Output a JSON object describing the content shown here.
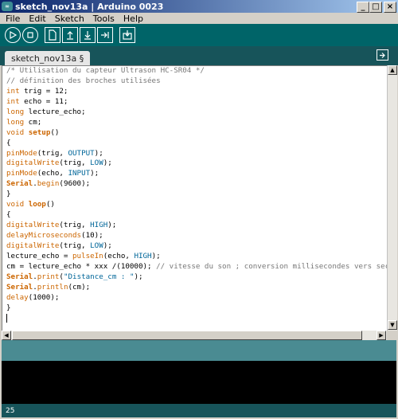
{
  "window": {
    "title": "sketch_nov13a | Arduino 0023",
    "app_icon": "arduino-icon"
  },
  "menubar": [
    "File",
    "Edit",
    "Sketch",
    "Tools",
    "Help"
  ],
  "toolbar": {
    "buttons": [
      "verify-icon",
      "stop-icon",
      "new-icon",
      "open-icon",
      "save-icon",
      "upload-icon",
      "serial-monitor-icon"
    ]
  },
  "tabs": [
    {
      "label": "sketch_nov13a §"
    }
  ],
  "editor": {
    "lines": [
      [
        {
          "t": "/* Utilisation du capteur Ultrason HC-SR04 */",
          "c": "comment"
        }
      ],
      [
        {
          "t": "// définition des broches utilisées",
          "c": "comment"
        }
      ],
      [
        {
          "t": "int",
          "c": "type"
        },
        {
          "t": " trig = 12;",
          "c": ""
        }
      ],
      [
        {
          "t": "int",
          "c": "type"
        },
        {
          "t": " echo = 11;",
          "c": ""
        }
      ],
      [
        {
          "t": "long",
          "c": "type"
        },
        {
          "t": " lecture_echo;",
          "c": ""
        }
      ],
      [
        {
          "t": "long",
          "c": "type"
        },
        {
          "t": " cm;",
          "c": ""
        }
      ],
      [
        {
          "t": "void",
          "c": "type"
        },
        {
          "t": " ",
          "c": ""
        },
        {
          "t": "setup",
          "c": "func-b"
        },
        {
          "t": "()",
          "c": ""
        }
      ],
      [
        {
          "t": "{",
          "c": ""
        }
      ],
      [
        {
          "t": "pinMode",
          "c": "func"
        },
        {
          "t": "(trig, ",
          "c": ""
        },
        {
          "t": "OUTPUT",
          "c": "const"
        },
        {
          "t": ");",
          "c": ""
        }
      ],
      [
        {
          "t": "digitalWrite",
          "c": "func"
        },
        {
          "t": "(trig, ",
          "c": ""
        },
        {
          "t": "LOW",
          "c": "const"
        },
        {
          "t": ");",
          "c": ""
        }
      ],
      [
        {
          "t": "pinMode",
          "c": "func"
        },
        {
          "t": "(echo, ",
          "c": ""
        },
        {
          "t": "INPUT",
          "c": "const"
        },
        {
          "t": ");",
          "c": ""
        }
      ],
      [
        {
          "t": "Serial",
          "c": "func-b"
        },
        {
          "t": ".",
          "c": ""
        },
        {
          "t": "begin",
          "c": "func"
        },
        {
          "t": "(9600);",
          "c": ""
        }
      ],
      [
        {
          "t": "}",
          "c": ""
        }
      ],
      [
        {
          "t": "void",
          "c": "type"
        },
        {
          "t": " ",
          "c": ""
        },
        {
          "t": "loop",
          "c": "func-b"
        },
        {
          "t": "()",
          "c": ""
        }
      ],
      [
        {
          "t": "{",
          "c": ""
        }
      ],
      [
        {
          "t": "digitalWrite",
          "c": "func"
        },
        {
          "t": "(trig, ",
          "c": ""
        },
        {
          "t": "HIGH",
          "c": "const"
        },
        {
          "t": ");",
          "c": ""
        }
      ],
      [
        {
          "t": "delayMicroseconds",
          "c": "func"
        },
        {
          "t": "(10);",
          "c": ""
        }
      ],
      [
        {
          "t": "digitalWrite",
          "c": "func"
        },
        {
          "t": "(trig, ",
          "c": ""
        },
        {
          "t": "LOW",
          "c": "const"
        },
        {
          "t": ");",
          "c": ""
        }
      ],
      [
        {
          "t": "lecture_echo = ",
          "c": ""
        },
        {
          "t": "pulseIn",
          "c": "func"
        },
        {
          "t": "(echo, ",
          "c": ""
        },
        {
          "t": "HIGH",
          "c": "const"
        },
        {
          "t": ");",
          "c": ""
        }
      ],
      [
        {
          "t": "cm = lecture_echo * xxx /(10000); ",
          "c": ""
        },
        {
          "t": "// vitesse du son ; conversion millisecondes vers second",
          "c": "comment"
        }
      ],
      [
        {
          "t": "Serial",
          "c": "func-b"
        },
        {
          "t": ".",
          "c": ""
        },
        {
          "t": "print",
          "c": "func"
        },
        {
          "t": "(",
          "c": ""
        },
        {
          "t": "\"Distance_cm : \"",
          "c": "str"
        },
        {
          "t": ");",
          "c": ""
        }
      ],
      [
        {
          "t": "Serial",
          "c": "func-b"
        },
        {
          "t": ".",
          "c": ""
        },
        {
          "t": "println",
          "c": "func"
        },
        {
          "t": "(cm);",
          "c": ""
        }
      ],
      [
        {
          "t": "delay",
          "c": "func"
        },
        {
          "t": "(1000);",
          "c": ""
        }
      ],
      [
        {
          "t": "}",
          "c": ""
        }
      ],
      [
        {
          "t": "",
          "c": "caret"
        }
      ]
    ]
  },
  "status": {
    "message": "",
    "line_number": "25"
  },
  "colors": {
    "toolbar": "#006468",
    "tabbar": "#17545a",
    "status": "#4a8b92",
    "keyword": "#cc6600",
    "constant": "#006699",
    "comment": "#777777"
  }
}
